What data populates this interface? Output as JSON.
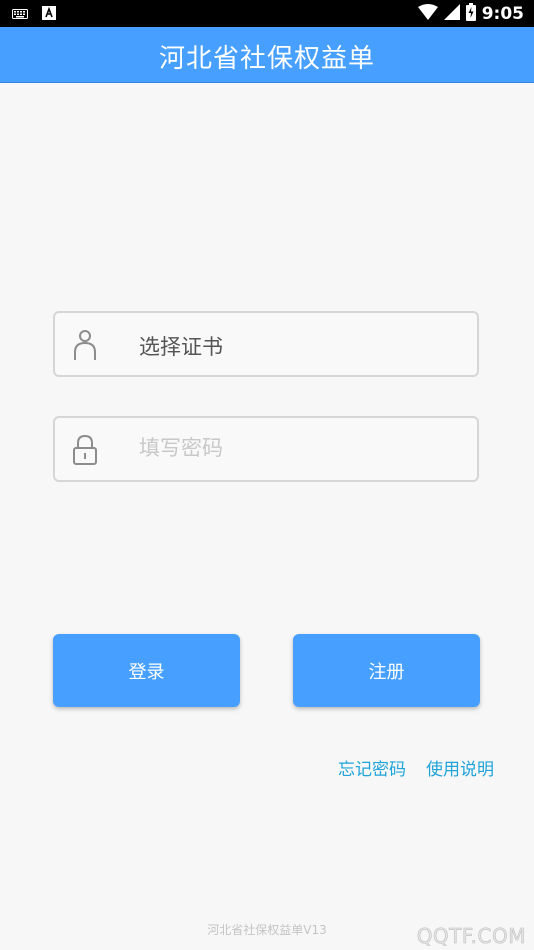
{
  "status_bar": {
    "time": "9:05",
    "left_icons": [
      "keyboard-icon",
      "a-notification-icon"
    ],
    "right_icons": [
      "wifi-icon",
      "signal-icon",
      "battery-icon"
    ]
  },
  "app_bar": {
    "title": "河北省社保权益单",
    "color": "#47a0ff"
  },
  "login_form": {
    "certificate_field": {
      "icon": "person-icon",
      "value": "选择证书"
    },
    "password_field": {
      "icon": "lock-icon",
      "placeholder": "填写密码"
    }
  },
  "buttons": {
    "login_label": "登录",
    "register_label": "注册"
  },
  "links": {
    "forgot_password": "忘记密码",
    "instructions": "使用说明"
  },
  "footer": {
    "version_text": "河北省社保权益单V13"
  },
  "watermark": "QQTF.COM"
}
